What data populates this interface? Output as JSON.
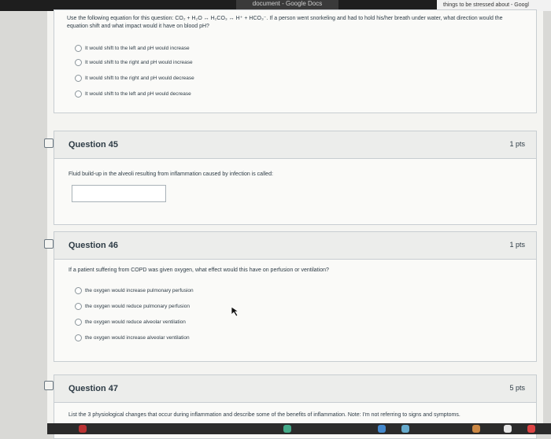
{
  "browser": {
    "docs_label": "document - Google Docs",
    "tab_title": "things to be stressed about - Googl"
  },
  "question44": {
    "prompt": "Use the following equation for this question: CO₂ + H₂O ↔ H₂CO₃ ↔ H⁺ + HCO₃⁻. If a person went snorkeling and had to hold his/her breath under water, what direction would the equation shift and what impact would it have on blood pH?",
    "answers": [
      "It would shift to the left and pH would increase",
      "It would shift to the right and pH would increase",
      "It would shift to the right and pH would decrease",
      "It would shift to the left and pH would decrease"
    ]
  },
  "question45": {
    "title": "Question 45",
    "points": "1 pts",
    "prompt": "Fluid build-up in the alveoli resulting from inflammation caused by infection is called:"
  },
  "question46": {
    "title": "Question 46",
    "points": "1 pts",
    "prompt": "If a patient suffering from COPD was given oxygen, what effect would this have on perfusion or ventilation?",
    "answers": [
      "the oxygen would increase pulmonary perfusion",
      "the oxygen would reduce pulmonary perfusion",
      "the oxygen would reduce alveolar ventilation",
      "the oxygen would increase alveolar ventilation"
    ]
  },
  "question47": {
    "title": "Question 47",
    "points": "5 pts",
    "prompt": "List the 3 physiological changes that occur during inflammation and describe some of the benefits of inflammation. Note: I'm not referring to signs and symptoms."
  }
}
